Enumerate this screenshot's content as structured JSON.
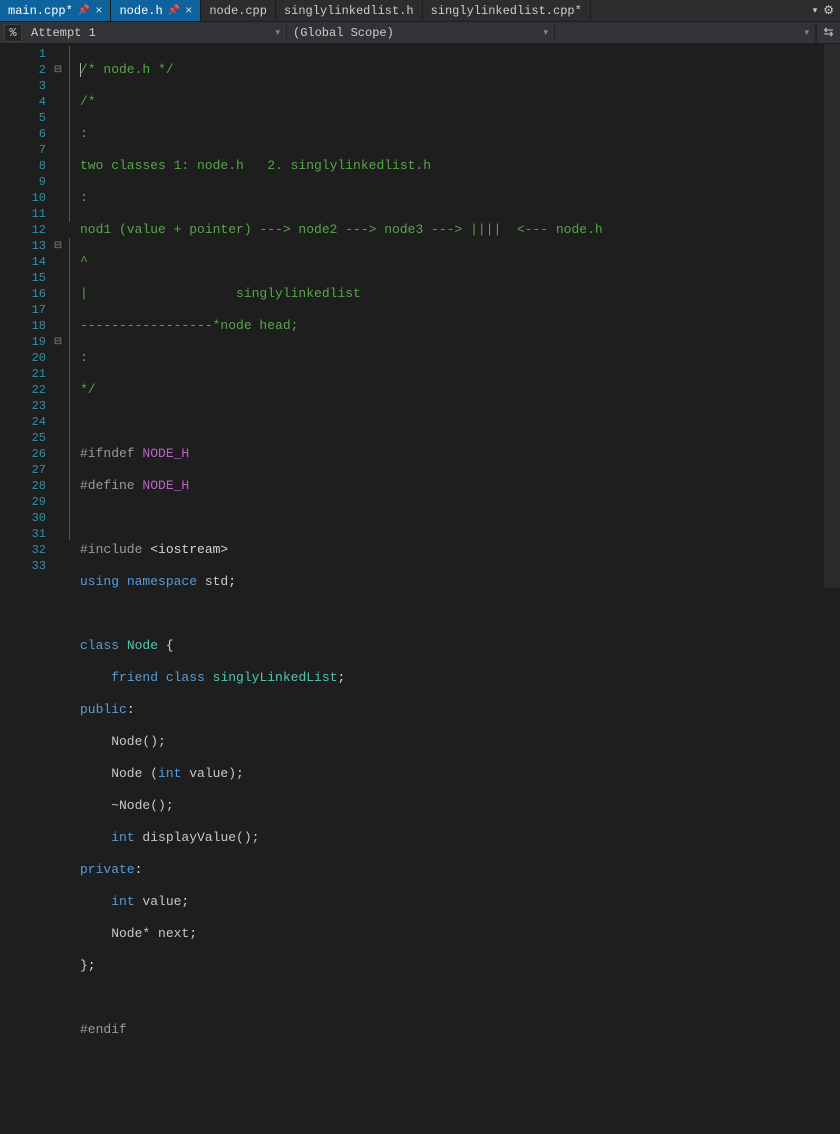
{
  "tabs": [
    {
      "label": "main.cpp*",
      "active": true,
      "pinned": true,
      "closeable": true
    },
    {
      "label": "node.h",
      "active": true,
      "pinned": true,
      "closeable": true
    },
    {
      "label": "node.cpp",
      "active": false,
      "pinned": false,
      "closeable": false
    },
    {
      "label": "singlylinkedlist.h",
      "active": false,
      "pinned": false,
      "closeable": false
    },
    {
      "label": "singlylinkedlist.cpp*",
      "active": false,
      "pinned": false,
      "closeable": false
    }
  ],
  "context": {
    "icon": "%",
    "scope1": "Attempt 1",
    "scope2": "(Global Scope)",
    "scope3": ""
  },
  "icons": {
    "pin": "📌",
    "close": "×",
    "dropdown": "▾",
    "gear": "⚙",
    "splitter": "⇆",
    "fold_minus": "⊟"
  },
  "line_numbers": [
    "1",
    "2",
    "3",
    "4",
    "5",
    "6",
    "7",
    "8",
    "9",
    "10",
    "11",
    "12",
    "13",
    "14",
    "15",
    "16",
    "17",
    "18",
    "19",
    "20",
    "21",
    "22",
    "23",
    "24",
    "25",
    "26",
    "27",
    "28",
    "29",
    "30",
    "31",
    "32",
    "33"
  ],
  "fold_rows": {
    "2": true,
    "13": true,
    "19": true
  },
  "code": {
    "l1": "/* node.h */",
    "l2": "/*",
    "l3": ":",
    "l4": "two classes 1: node.h   2. singlylinkedlist.h",
    "l5": ":",
    "l6": "nod1 (value + pointer) ---> node2 ---> node3 ---> ||||  <--- node.h",
    "l7": "^",
    "l8": "|                   singlylinkedlist",
    "l9": "-----------------*node head;",
    "l10": ":",
    "l11": "*/",
    "l13_a": "#ifndef ",
    "l13_b": "NODE_H",
    "l14_a": "#define ",
    "l14_b": "NODE_H",
    "l16_a": "#include ",
    "l16_b": "<iostream>",
    "l17_a": "using",
    "l17_b": " namespace",
    "l17_c": " std",
    "l17_d": ";",
    "l19_a": "class",
    "l19_b": " Node",
    "l19_c": " {",
    "l20_a": "    ",
    "l20_b": "friend",
    "l20_c": " class",
    "l20_d": " singlyLinkedList",
    "l20_e": ";",
    "l21_a": "public",
    "l21_b": ":",
    "l22_a": "    Node();",
    "l23_a": "    Node (",
    "l23_b": "int",
    "l23_c": " value);",
    "l24_a": "    ~Node();",
    "l25_a": "    ",
    "l25_b": "int",
    "l25_c": " displayValue();",
    "l26_a": "private",
    "l26_b": ":",
    "l27_a": "    ",
    "l27_b": "int",
    "l27_c": " value;",
    "l28_a": "    Node* next;",
    "l29_a": "};",
    "l31_a": "#endif"
  }
}
